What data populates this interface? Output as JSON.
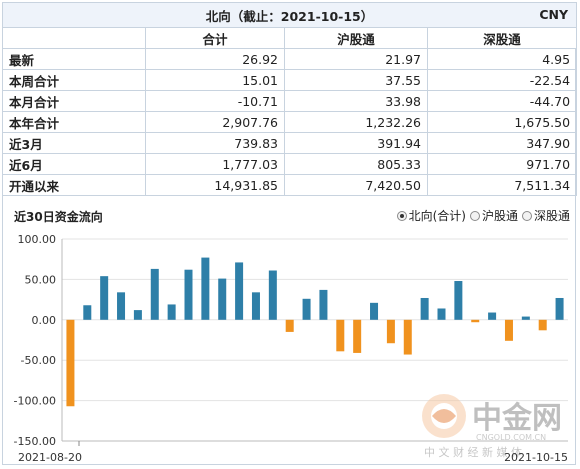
{
  "table": {
    "title": "北向（截止：2021-10-15）",
    "currency": "CNY",
    "columns": [
      "合计",
      "沪股通",
      "深股通"
    ],
    "rows": [
      {
        "label": "最新",
        "values": [
          "26.92",
          "21.97",
          "4.95"
        ]
      },
      {
        "label": "本周合计",
        "values": [
          "15.01",
          "37.55",
          "-22.54"
        ]
      },
      {
        "label": "本月合计",
        "values": [
          "-10.71",
          "33.98",
          "-44.70"
        ]
      },
      {
        "label": "本年合计",
        "values": [
          "2,907.76",
          "1,232.26",
          "1,675.50"
        ]
      },
      {
        "label": "近3月",
        "values": [
          "739.83",
          "391.94",
          "347.90"
        ]
      },
      {
        "label": "近6月",
        "values": [
          "1,777.03",
          "805.33",
          "971.70"
        ]
      },
      {
        "label": "开通以来",
        "values": [
          "14,931.85",
          "7,420.50",
          "7,511.34"
        ]
      }
    ]
  },
  "chart_title": "近30日资金流向",
  "radios": [
    {
      "label": "北向(合计)",
      "checked": true
    },
    {
      "label": "沪股通",
      "checked": false
    },
    {
      "label": "深股通",
      "checked": false
    }
  ],
  "watermark": {
    "brand": "中金网",
    "domain": "CNGOLD.COM.CN",
    "tagline": "中 文 财 经 新 媒 体"
  },
  "colors": {
    "positive": "#2e7fa8",
    "negative": "#f0921e",
    "grid": "#e3e3e3",
    "border": "#c8d3df"
  },
  "chart_data": {
    "type": "bar",
    "title": "近30日资金流向",
    "ylim": [
      -150,
      100
    ],
    "yticks": [
      "100.00",
      "50.00",
      "0.00",
      "-50.00",
      "-100.00",
      "-150.00"
    ],
    "ytick_values": [
      100,
      50,
      0,
      -50,
      -100,
      -150
    ],
    "x_start_label": "2021-08-20",
    "x_end_label": "2021-10-15",
    "grid": true,
    "values": [
      -107,
      18,
      54,
      34,
      12,
      63,
      19,
      62,
      77,
      51,
      71,
      34,
      61,
      -15,
      26,
      37,
      -39,
      -41,
      21,
      -29,
      -43,
      27,
      14,
      48,
      -3,
      9,
      -26,
      4,
      -13,
      27
    ]
  }
}
